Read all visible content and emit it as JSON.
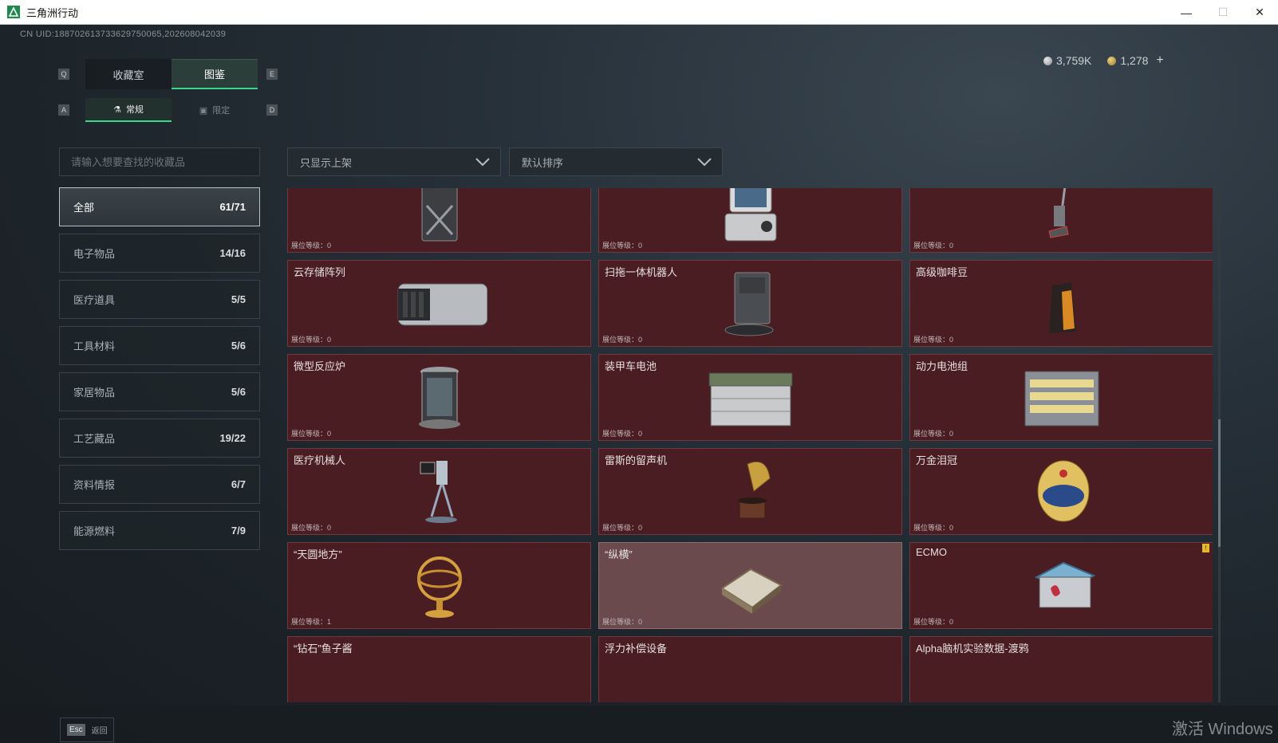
{
  "window": {
    "title": "三角洲行动",
    "minimize": "—",
    "maximize": "☐",
    "close": "✕"
  },
  "uid": "CN UID:188702613733629750065,202608042039",
  "currency": {
    "silver": "3,759K",
    "gold": "1,278",
    "add": "+"
  },
  "keys": {
    "q": "Q",
    "e": "E",
    "a": "A",
    "d": "D"
  },
  "tabs": [
    {
      "label": "收藏室"
    },
    {
      "label": "图鉴"
    }
  ],
  "subtabs": [
    {
      "label": "常规"
    },
    {
      "label": "限定"
    }
  ],
  "search": {
    "placeholder": "请输入想要查找的收藏品"
  },
  "filters": {
    "shelf": "只显示上架",
    "sort": "默认排序"
  },
  "categories": [
    {
      "label": "全部",
      "count": "61/71"
    },
    {
      "label": "电子物品",
      "count": "14/16"
    },
    {
      "label": "医疗道具",
      "count": "5/5"
    },
    {
      "label": "工具材料",
      "count": "5/6"
    },
    {
      "label": "家居物品",
      "count": "5/6"
    },
    {
      "label": "工艺藏品",
      "count": "19/22"
    },
    {
      "label": "资料情报",
      "count": "6/7"
    },
    {
      "label": "能源燃料",
      "count": "7/9"
    }
  ],
  "items": [
    {
      "name": "",
      "level": "展位等级：0",
      "icon": "canister-icon"
    },
    {
      "name": "",
      "level": "展位等级：0",
      "icon": "terminal-icon"
    },
    {
      "name": "",
      "level": "展位等级：0",
      "icon": "vacuum-icon"
    },
    {
      "name": "云存储阵列",
      "level": "展位等级：0",
      "icon": "storage-array-icon"
    },
    {
      "name": "扫拖一体机器人",
      "level": "展位等级：0",
      "icon": "mop-robot-icon"
    },
    {
      "name": "高级咖啡豆",
      "level": "展位等级：0",
      "icon": "coffee-bag-icon"
    },
    {
      "name": "微型反应炉",
      "level": "展位等级：0",
      "icon": "reactor-icon"
    },
    {
      "name": "装甲车电池",
      "level": "展位等级：0",
      "icon": "battery-icon"
    },
    {
      "name": "动力电池组",
      "level": "展位等级：0",
      "icon": "battery-pack-icon"
    },
    {
      "name": "医疗机械人",
      "level": "展位等级：0",
      "icon": "medical-robot-icon"
    },
    {
      "name": "雷斯的留声机",
      "level": "展位等级：0",
      "icon": "gramophone-icon"
    },
    {
      "name": "万金泪冠",
      "level": "展位等级：0",
      "icon": "jeweled-egg-icon"
    },
    {
      "name": "“天圆地方”",
      "level": "展位等级：1",
      "icon": "armillary-icon"
    },
    {
      "name": "“纵横”",
      "level": "展位等级：0",
      "icon": "chessboard-icon"
    },
    {
      "name": "ECMO",
      "level": "展位等级：0",
      "icon": "ecmo-icon",
      "mark": "!"
    },
    {
      "name": "“钻石”鱼子酱",
      "level": "",
      "icon": "caviar-icon"
    },
    {
      "name": "浮力补偿设备",
      "level": "",
      "icon": "bcd-icon"
    },
    {
      "name": "Alpha脑机实验数据-渡鸦",
      "level": "",
      "icon": "data-device-icon"
    }
  ],
  "bottom": {
    "esc_key": "Esc",
    "esc_label": "返回"
  },
  "watermark": "激活 Windows",
  "colors": {
    "accent": "#3dd68c",
    "card_bg": "#4a1d22",
    "card_highlight": "#6a4a4d"
  }
}
